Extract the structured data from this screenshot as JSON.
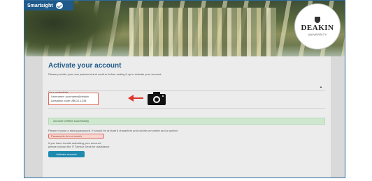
{
  "app": {
    "brand": "Smartsight",
    "logo_name": "DEAKIN",
    "logo_sub": "UNIVERSITY"
  },
  "page": {
    "title": "Activate your account",
    "intro": "Please provide your new password and confirm before setting it up to activate your account.",
    "section": "Your credentials",
    "details_line1": "Username: yourname@deakin",
    "details_line2": "Activation code: ABCD-1234",
    "green_msg": "Account verified successfully",
    "note": "Please choose a strong password. It should be at least 8 characters and contain a number and a symbol.",
    "highlight": "Passwords do not match",
    "note2a": "If you have trouble activating your account,",
    "note2b": "please contact the IT Service Desk for assistance.",
    "button": "Activate account"
  },
  "icons": {
    "camera": "camera-icon",
    "arrow": "arrow-left-icon"
  },
  "colors": {
    "accent": "#1f5a8a",
    "highlight": "#e06a5e",
    "button": "#1f8ab0",
    "success_bg": "#cfe6cf"
  }
}
